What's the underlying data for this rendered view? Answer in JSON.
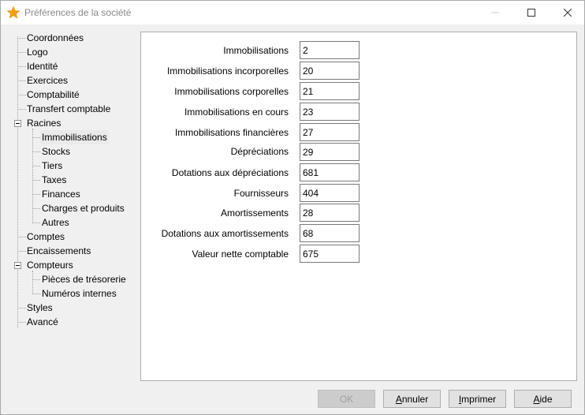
{
  "window": {
    "title": "Préférences de la société",
    "accent_color": "#f5a000"
  },
  "tree": {
    "items": [
      {
        "label": "Coordonnées"
      },
      {
        "label": "Logo"
      },
      {
        "label": "Identité"
      },
      {
        "label": "Exercices"
      },
      {
        "label": "Comptabilité"
      },
      {
        "label": "Transfert comptable"
      },
      {
        "label": "Racines",
        "expanded": true
      },
      {
        "label": "Immobilisations",
        "selected": true
      },
      {
        "label": "Stocks"
      },
      {
        "label": "Tiers"
      },
      {
        "label": "Taxes"
      },
      {
        "label": "Finances"
      },
      {
        "label": "Charges et produits"
      },
      {
        "label": "Autres"
      },
      {
        "label": "Comptes"
      },
      {
        "label": "Encaissements"
      },
      {
        "label": "Compteurs",
        "expanded": true
      },
      {
        "label": "Pièces de trésorerie"
      },
      {
        "label": "Numéros internes"
      },
      {
        "label": "Styles"
      },
      {
        "label": "Avancé"
      }
    ]
  },
  "form": {
    "fields": [
      {
        "label": "Immobilisations",
        "value": "2"
      },
      {
        "label": "Immobilisations incorporelles",
        "value": "20"
      },
      {
        "label": "Immobilisations corporelles",
        "value": "21"
      },
      {
        "label": "Immobilisations en cours",
        "value": "23"
      },
      {
        "label": "Immobilisations financières",
        "value": "27"
      },
      {
        "label": "Dépréciations",
        "value": "29"
      },
      {
        "label": "Dotations aux dépréciations",
        "value": "681"
      },
      {
        "label": "Fournisseurs",
        "value": "404"
      },
      {
        "label": "Amortissements",
        "value": "28"
      },
      {
        "label": "Dotations aux amortissements",
        "value": "68"
      },
      {
        "label": "Valeur nette comptable",
        "value": "675"
      }
    ]
  },
  "buttons": {
    "ok": "OK",
    "cancel_first": "A",
    "cancel_rest": "nnuler",
    "print_first": "I",
    "print_rest": "mprimer",
    "help_first": "A",
    "help_rest": "ide"
  }
}
